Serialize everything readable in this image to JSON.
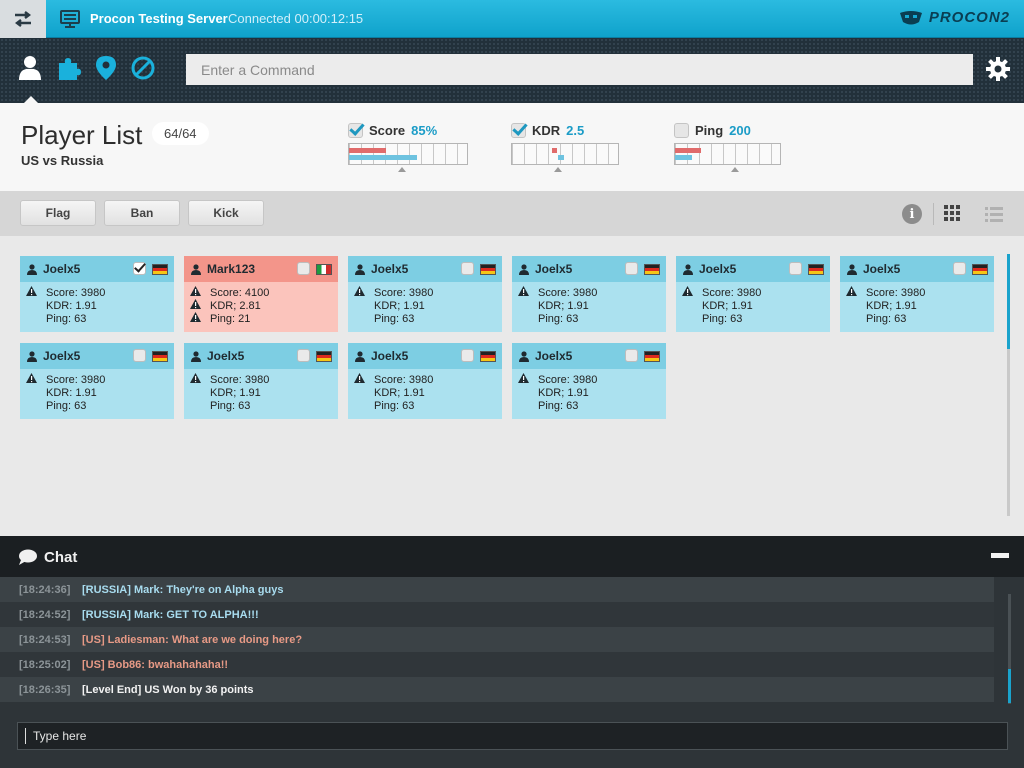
{
  "topbar": {
    "server_name": "Procon Testing Server",
    "status": "Connected 00:00:12:15",
    "logo_text": "PROCON2",
    "accent": "#15a9d3"
  },
  "nav": {
    "icons": [
      "player-icon",
      "plugin-puzzle-icon",
      "map-pin-icon",
      "ban-icon"
    ],
    "command_placeholder": "Enter a Command"
  },
  "header": {
    "title": "Player List",
    "count": "64/64",
    "subtitle": "US vs Russia"
  },
  "metrics": [
    {
      "label": "Score",
      "value": "85%",
      "checked": true,
      "red_fraction": 0.31,
      "blue_fraction": 0.58,
      "marker_fraction": 0.45
    },
    {
      "label": "KDR",
      "value": "2.5",
      "checked": true,
      "red_fraction": 0.05,
      "blue_fraction": 0.06,
      "marker_fraction": 0.43
    },
    {
      "label": "Ping",
      "value": "200",
      "checked": false,
      "red_fraction": 0.25,
      "blue_fraction": 0.16,
      "marker_fraction": 0.57
    }
  ],
  "actions": {
    "flag": "Flag",
    "ban": "Ban",
    "kick": "Kick"
  },
  "players": [
    {
      "name": "Joelx5",
      "score": "Score: 3980",
      "kdr": "KDR: 1.91",
      "ping": "Ping: 63",
      "checked": true,
      "flag": "germany",
      "warn": [
        true,
        false,
        false
      ],
      "alert": false
    },
    {
      "name": "Mark123",
      "score": "Score: 4100",
      "kdr": "KDR; 2.81",
      "ping": "Ping: 21",
      "checked": false,
      "flag": "italy",
      "warn": [
        true,
        true,
        true
      ],
      "alert": true
    },
    {
      "name": "Joelx5",
      "score": "Score: 3980",
      "kdr": "KDR; 1.91",
      "ping": "Ping: 63",
      "checked": false,
      "flag": "germany",
      "warn": [
        true,
        false,
        false
      ],
      "alert": false
    },
    {
      "name": "Joelx5",
      "score": "Score: 3980",
      "kdr": "KDR; 1.91",
      "ping": "Ping: 63",
      "checked": false,
      "flag": "germany",
      "warn": [
        true,
        false,
        false
      ],
      "alert": false
    },
    {
      "name": "Joelx5",
      "score": "Score: 3980",
      "kdr": "KDR; 1.91",
      "ping": "Ping: 63",
      "checked": false,
      "flag": "germany",
      "warn": [
        true,
        false,
        false
      ],
      "alert": false
    },
    {
      "name": "Joelx5",
      "score": "Score: 3980",
      "kdr": "KDR; 1.91",
      "ping": "Ping: 63",
      "checked": false,
      "flag": "germany",
      "warn": [
        true,
        false,
        false
      ],
      "alert": false
    },
    {
      "name": "Joelx5",
      "score": "Score: 3980",
      "kdr": "KDR: 1.91",
      "ping": "Ping: 63",
      "checked": false,
      "flag": "germany",
      "warn": [
        true,
        false,
        false
      ],
      "alert": false
    },
    {
      "name": "Joelx5",
      "score": "Score: 3980",
      "kdr": "KDR; 1.91",
      "ping": "Ping: 63",
      "checked": false,
      "flag": "germany",
      "warn": [
        true,
        false,
        false
      ],
      "alert": false
    },
    {
      "name": "Joelx5",
      "score": "Score: 3980",
      "kdr": "KDR; 1.91",
      "ping": "Ping: 63",
      "checked": false,
      "flag": "germany",
      "warn": [
        true,
        false,
        false
      ],
      "alert": false
    },
    {
      "name": "Joelx5",
      "score": "Score: 3980",
      "kdr": "KDR; 1.91",
      "ping": "Ping: 63",
      "checked": false,
      "flag": "germany",
      "warn": [
        true,
        false,
        false
      ],
      "alert": false
    }
  ],
  "chat": {
    "title": "Chat",
    "messages": [
      {
        "time": "[18:24:36]",
        "text": "[RUSSIA] Mark: They're on Alpha guys",
        "team": "russia"
      },
      {
        "time": "[18:24:52]",
        "text": "[RUSSIA] Mark: GET TO ALPHA!!!",
        "team": "russia"
      },
      {
        "time": "[18:24:53]",
        "text": "[US] Ladiesman: What are we doing here?",
        "team": "us"
      },
      {
        "time": "[18:25:02]",
        "text": "[US] Bob86: bwahahahaha!!",
        "team": "us"
      },
      {
        "time": "[18:26:35]",
        "text": "[Level End] US Won by 36 points",
        "team": "system"
      }
    ],
    "input_placeholder": "Type here"
  }
}
